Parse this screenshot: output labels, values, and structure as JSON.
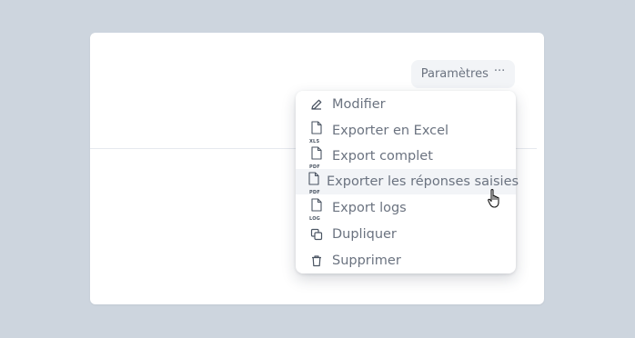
{
  "header": {
    "params_label": "Paramètres",
    "params_more": "···"
  },
  "menu": {
    "items": [
      {
        "label": "Modifier",
        "icon": "pencil-icon"
      },
      {
        "label": "Exporter en Excel",
        "icon": "file-xls-icon",
        "badge": "XLS"
      },
      {
        "label": "Export complet",
        "icon": "file-pdf-icon",
        "badge": "PDF"
      },
      {
        "label": "Exporter les réponses saisies",
        "icon": "file-pdf-icon",
        "badge": "PDF",
        "hovered": true
      },
      {
        "label": "Export logs",
        "icon": "file-log-icon",
        "badge": "LOG"
      },
      {
        "label": "Dupliquer",
        "icon": "duplicate-icon"
      },
      {
        "label": "Supprimer",
        "icon": "trash-icon"
      }
    ]
  },
  "colors": {
    "background": "#cdd5de",
    "text": "#6b7380",
    "hover": "#f2f4f7",
    "icon": "#4b5563"
  }
}
